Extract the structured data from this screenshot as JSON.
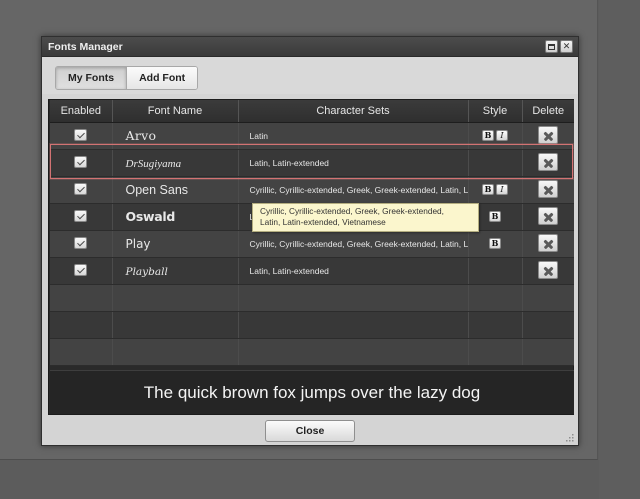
{
  "window": {
    "title": "Fonts Manager"
  },
  "tabs": [
    {
      "label": "My Fonts",
      "active": true
    },
    {
      "label": "Add Font",
      "active": false
    }
  ],
  "columns": {
    "enabled": "Enabled",
    "font_name": "Font Name",
    "character_sets": "Character Sets",
    "style": "Style",
    "delete": "Delete"
  },
  "fonts": [
    {
      "name": "Arvo",
      "charsets": "Latin",
      "enabled": true,
      "bold_btn": "B",
      "italic_btn": "I"
    },
    {
      "name": "DrSugiyama",
      "charsets": "Latin, Latin-extended",
      "enabled": true
    },
    {
      "name": "Open Sans",
      "charsets": "Cyrillic, Cyrillic-extended, Greek, Greek-extended, Latin, L",
      "enabled": true,
      "bold_btn": "B",
      "italic_btn": "I"
    },
    {
      "name": "Oswald",
      "charsets": "L",
      "enabled": true,
      "bold_btn": "B"
    },
    {
      "name": "Play",
      "charsets": "Cyrillic, Cyrillic-extended, Greek, Greek-extended, Latin, L",
      "enabled": true,
      "bold_btn": "B"
    },
    {
      "name": "Playball",
      "charsets": "Latin, Latin-extended",
      "enabled": true
    }
  ],
  "tooltip": {
    "line1": "Cyrillic, Cyrillic-extended, Greek, Greek-extended,",
    "line2": "Latin, Latin-extended, Vietnamese"
  },
  "preview_text": "The quick brown fox jumps over the lazy dog",
  "footer": {
    "close_label": "Close"
  },
  "colors": {
    "highlight": "#d37373",
    "tooltip_bg": "#fbf6cd",
    "row_odd": "#434343",
    "row_even": "#383838"
  }
}
